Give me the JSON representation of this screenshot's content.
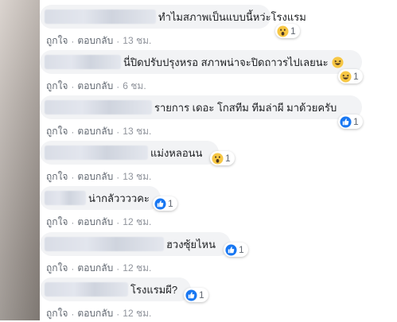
{
  "actions": {
    "like": "ถูกใจ",
    "reply": "ตอบกลับ",
    "separator": "·"
  },
  "comments": [
    {
      "text": "ทำไมสภาพเป็นแบบนี้หว่ะโรงแรม",
      "reaction": "wow-icon",
      "count": "1",
      "time": "13 ชม."
    },
    {
      "text": "นี่ปิดปรับปรุงหรอ สภาพน่าจะปิดถาวรไปเลยนะ",
      "reaction": "haha-icon",
      "count": "1",
      "time": "6 ชม."
    },
    {
      "text": "รายการ เดอะ โกสทีม ทีมล่าผี มาด้วยครับ",
      "reaction": "like-icon",
      "count": "1",
      "time": "13 ชม."
    },
    {
      "text": "แม่งหลอนน",
      "reaction": "wow-icon",
      "count": "1",
      "time": "13 ชม."
    },
    {
      "text": "น่ากลัววววคะ",
      "reaction": "like-icon",
      "count": "1",
      "time": "12 ชม."
    },
    {
      "text": "ฮวงซุ้ยไหน",
      "reaction": "like-icon",
      "count": "1",
      "time": "12 ชม."
    },
    {
      "text": "โรงแรมผี?",
      "reaction": "like-icon",
      "count": "1",
      "time": "12 ชม."
    }
  ],
  "colors": {
    "bubble": "#f2f3f5",
    "like_blue": "#1877f2",
    "emoji_yellow": "#f7c744",
    "meta_text": "#90949c"
  }
}
